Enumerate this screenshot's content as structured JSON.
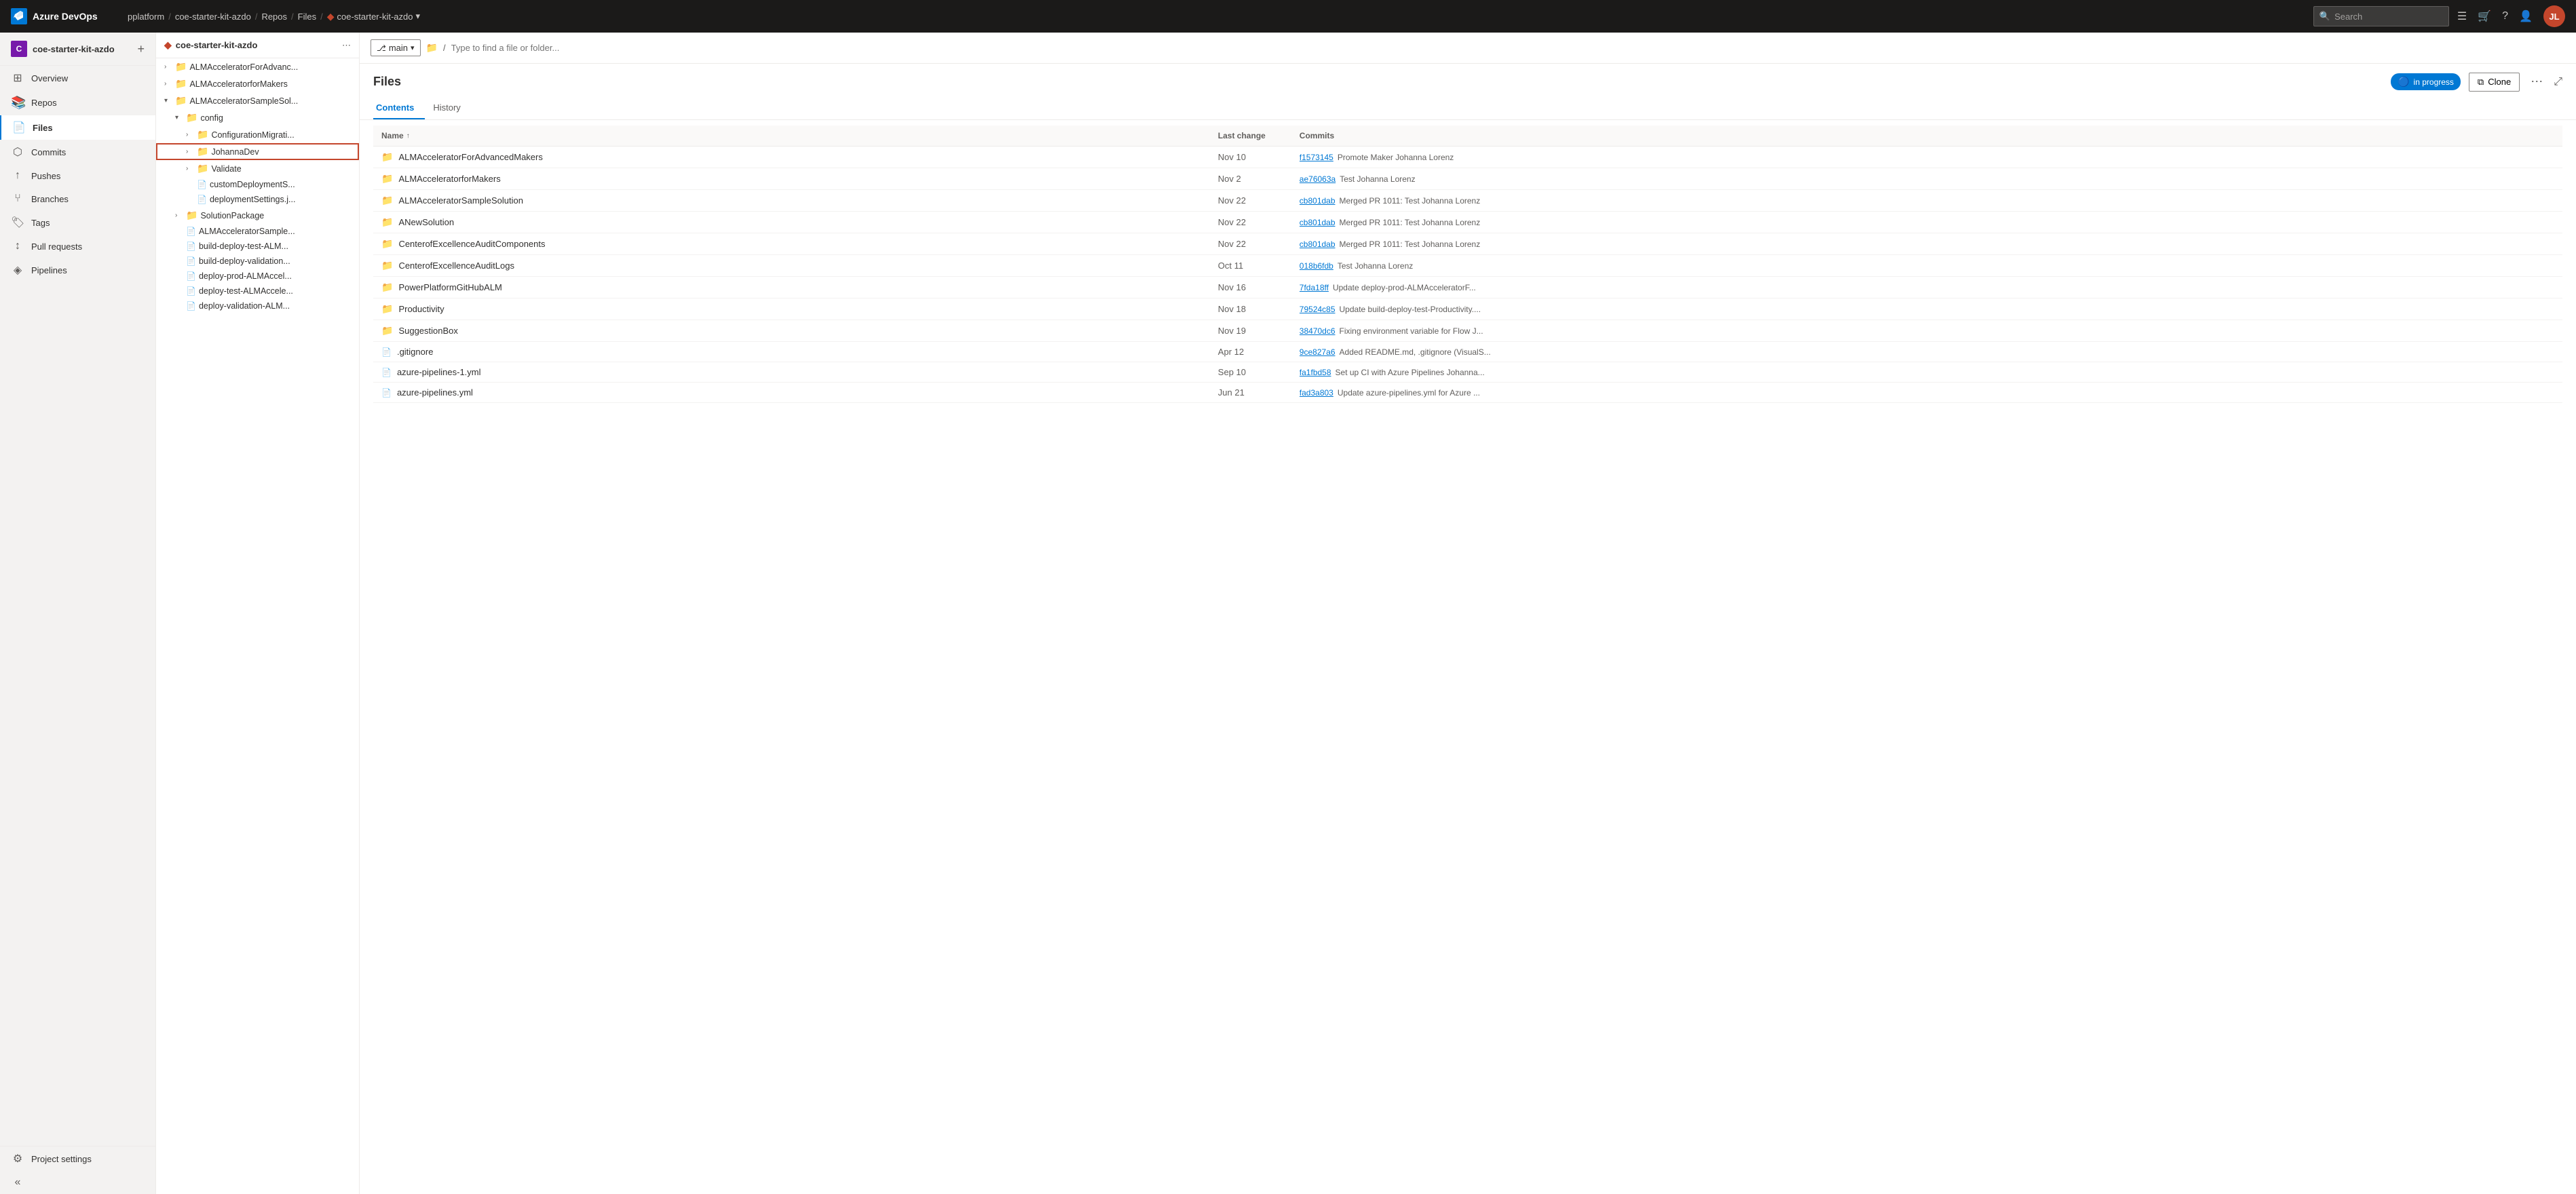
{
  "topNav": {
    "logo": "Azure DevOps",
    "breadcrumb": {
      "parts": [
        "pplatform",
        "coe-starter-kit-azdo",
        "Repos",
        "Files"
      ],
      "current": "coe-starter-kit-azdo"
    },
    "search": {
      "placeholder": "Search"
    },
    "userInitials": "JL"
  },
  "sidebar": {
    "project": {
      "name": "coe-starter-kit-azdo",
      "initials": "C"
    },
    "navItems": [
      {
        "id": "overview",
        "label": "Overview",
        "icon": "⊞"
      },
      {
        "id": "repos",
        "label": "Repos",
        "icon": "📁"
      },
      {
        "id": "files",
        "label": "Files",
        "icon": "📄",
        "active": true
      },
      {
        "id": "commits",
        "label": "Commits",
        "icon": "⬡"
      },
      {
        "id": "pushes",
        "label": "Pushes",
        "icon": "↑"
      },
      {
        "id": "branches",
        "label": "Branches",
        "icon": "⑂"
      },
      {
        "id": "tags",
        "label": "Tags",
        "icon": "🏷"
      },
      {
        "id": "pullrequests",
        "label": "Pull requests",
        "icon": "↕"
      },
      {
        "id": "pipelines",
        "label": "Pipelines",
        "icon": "◈"
      }
    ],
    "projectSettings": "Project settings"
  },
  "fileTree": {
    "repoName": "coe-starter-kit-azdo",
    "items": [
      {
        "id": "almacc-adv",
        "label": "ALMAcceleratorForAdvanc...",
        "type": "folder",
        "indent": 0,
        "expanded": false
      },
      {
        "id": "almacc-makers",
        "label": "ALMAcceleratorforMakers",
        "type": "folder",
        "indent": 0,
        "expanded": false
      },
      {
        "id": "almacc-sample",
        "label": "ALMAcceleratorSampleSol...",
        "type": "folder",
        "indent": 0,
        "expanded": true
      },
      {
        "id": "config",
        "label": "config",
        "type": "folder",
        "indent": 1,
        "expanded": true
      },
      {
        "id": "configmig",
        "label": "ConfigurationMigrati...",
        "type": "folder",
        "indent": 2,
        "expanded": false
      },
      {
        "id": "johannadev",
        "label": "JohannaDev",
        "type": "folder",
        "indent": 2,
        "expanded": false,
        "highlighted": true
      },
      {
        "id": "validate",
        "label": "Validate",
        "type": "folder",
        "indent": 2,
        "expanded": false
      },
      {
        "id": "customdeploy",
        "label": "customDeploymentS...",
        "type": "file",
        "indent": 2
      },
      {
        "id": "deploysettings",
        "label": "deploymentSettings.j...",
        "type": "file",
        "indent": 2
      },
      {
        "id": "solutionpkg",
        "label": "SolutionPackage",
        "type": "folder",
        "indent": 1,
        "expanded": false
      },
      {
        "id": "almacc-sample2",
        "label": "ALMAcceleratorSample...",
        "type": "file",
        "indent": 1
      },
      {
        "id": "build-deploy-test",
        "label": "build-deploy-test-ALM...",
        "type": "file",
        "indent": 1
      },
      {
        "id": "build-deploy-val",
        "label": "build-deploy-validation...",
        "type": "file",
        "indent": 1
      },
      {
        "id": "deploy-prod",
        "label": "deploy-prod-ALMAccel...",
        "type": "file",
        "indent": 1
      },
      {
        "id": "deploy-test",
        "label": "deploy-test-ALMAccele...",
        "type": "file",
        "indent": 1
      },
      {
        "id": "deploy-validation",
        "label": "deploy-validation-ALM...",
        "type": "file",
        "indent": 1
      }
    ]
  },
  "filesView": {
    "branch": "main",
    "pathPlaceholder": "Type to find a file or folder...",
    "title": "Files",
    "inProgressLabel": "in progress",
    "cloneLabel": "Clone",
    "tabs": [
      {
        "id": "contents",
        "label": "Contents",
        "active": true
      },
      {
        "id": "history",
        "label": "History",
        "active": false
      }
    ],
    "table": {
      "headers": {
        "name": "Name",
        "lastChange": "Last change",
        "commits": "Commits"
      },
      "rows": [
        {
          "type": "folder",
          "name": "ALMAcceleratorForAdvancedMakers",
          "lastChange": "Nov 10",
          "commitHash": "f1573145",
          "commitMsg": "Promote Maker Johanna Lorenz"
        },
        {
          "type": "folder",
          "name": "ALMAcceleratorforMakers",
          "lastChange": "Nov 2",
          "commitHash": "ae76063a",
          "commitMsg": "Test Johanna Lorenz"
        },
        {
          "type": "folder",
          "name": "ALMAcceleratorSampleSolution",
          "lastChange": "Nov 22",
          "commitHash": "cb801dab",
          "commitMsg": "Merged PR 1011: Test Johanna Lorenz"
        },
        {
          "type": "folder",
          "name": "ANewSolution",
          "lastChange": "Nov 22",
          "commitHash": "cb801dab",
          "commitMsg": "Merged PR 1011: Test Johanna Lorenz"
        },
        {
          "type": "folder",
          "name": "CenterofExcellenceAuditComponents",
          "lastChange": "Nov 22",
          "commitHash": "cb801dab",
          "commitMsg": "Merged PR 1011: Test Johanna Lorenz"
        },
        {
          "type": "folder",
          "name": "CenterofExcellenceAuditLogs",
          "lastChange": "Oct 11",
          "commitHash": "018b6fdb",
          "commitMsg": "Test Johanna Lorenz"
        },
        {
          "type": "folder",
          "name": "PowerPlatformGitHubALM",
          "lastChange": "Nov 16",
          "commitHash": "7fda18ff",
          "commitMsg": "Update deploy-prod-ALMAcceleratorF..."
        },
        {
          "type": "folder",
          "name": "Productivity",
          "lastChange": "Nov 18",
          "commitHash": "79524c85",
          "commitMsg": "Update build-deploy-test-Productivity...."
        },
        {
          "type": "folder",
          "name": "SuggestionBox",
          "lastChange": "Nov 19",
          "commitHash": "38470dc6",
          "commitMsg": "Fixing environment variable for Flow J..."
        },
        {
          "type": "file",
          "name": ".gitignore",
          "lastChange": "Apr 12",
          "commitHash": "9ce827a6",
          "commitMsg": "Added README.md, .gitignore (VisualS..."
        },
        {
          "type": "file",
          "name": "azure-pipelines-1.yml",
          "lastChange": "Sep 10",
          "commitHash": "fa1fbd58",
          "commitMsg": "Set up CI with Azure Pipelines Johanna..."
        },
        {
          "type": "file",
          "name": "azure-pipelines.yml",
          "lastChange": "Jun 21",
          "commitHash": "fad3a803",
          "commitMsg": "Update azure-pipelines.yml for Azure ..."
        }
      ]
    }
  }
}
